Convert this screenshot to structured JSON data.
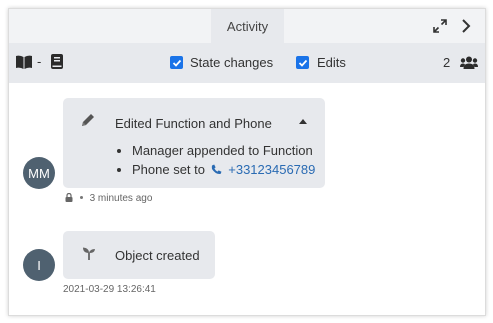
{
  "header": {
    "tab_label": "Activity"
  },
  "toolbar": {
    "separator": "-",
    "state_changes_label": "State changes",
    "state_changes_checked": true,
    "edits_label": "Edits",
    "edits_checked": true,
    "followers_count": "2"
  },
  "messages": [
    {
      "avatar_initials": "MM",
      "title": "Edited Function and Phone",
      "changes": [
        {
          "text": "Manager appended to Function"
        },
        {
          "text": "Phone set to",
          "link": "+33123456789"
        }
      ],
      "time": "3 minutes ago",
      "icon": "pencil-icon"
    },
    {
      "avatar_initials": "I",
      "title": "Object created",
      "time": "2021-03-29 13:26:41",
      "icon": "sprout-icon"
    }
  ],
  "colors": {
    "accent": "#1a73e8",
    "link": "#2a6bb3",
    "avatar": "#4f6170",
    "bubble": "#e7e9ed"
  }
}
